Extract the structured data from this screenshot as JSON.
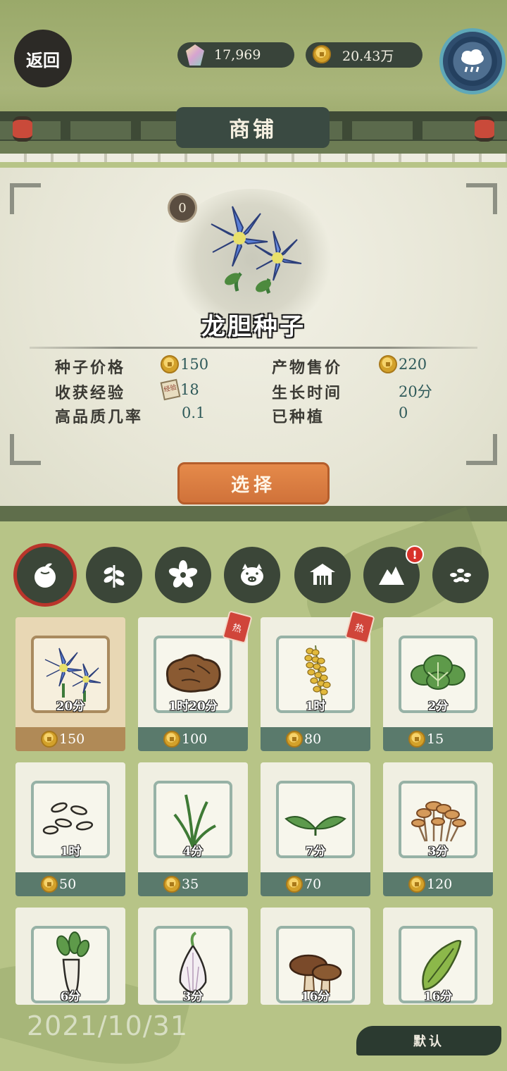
{
  "header": {
    "back_label": "返回",
    "gems": "17,969",
    "coins": "20.43万",
    "shop_title": "商铺"
  },
  "detail": {
    "owned_count": "0",
    "name": "龙胆种子",
    "stats": [
      {
        "label": "种子价格",
        "value": "150",
        "icon": "coin-icon"
      },
      {
        "label": "产物售价",
        "value": "220",
        "icon": "coin-icon"
      },
      {
        "label": "收获经验",
        "value": "18",
        "icon": "scroll-icon"
      },
      {
        "label": "生长时间",
        "value": "20分",
        "icon": ""
      },
      {
        "label": "高品质几率",
        "value": "0.1",
        "icon": ""
      },
      {
        "label": "已种植",
        "value": "0",
        "icon": ""
      }
    ],
    "select_label": "选择"
  },
  "tabs": [
    {
      "name": "crop",
      "icon": "fruit-icon",
      "active": true
    },
    {
      "name": "herb",
      "icon": "herb-icon",
      "active": false
    },
    {
      "name": "flower",
      "icon": "flower-icon",
      "active": false
    },
    {
      "name": "livestock",
      "icon": "pig-icon",
      "active": false
    },
    {
      "name": "building",
      "icon": "house-icon",
      "active": false
    },
    {
      "name": "mountain",
      "icon": "mountain-icon",
      "active": false,
      "alert": "!"
    },
    {
      "name": "seeds",
      "icon": "seeds-icon",
      "active": false
    }
  ],
  "items": [
    {
      "art": "gentian-flower",
      "time": "20分",
      "price": "150",
      "selected": true,
      "tag": false
    },
    {
      "art": "ginseng-root",
      "time": "1时20分",
      "price": "100",
      "selected": false,
      "tag": true
    },
    {
      "art": "millet",
      "time": "1时",
      "price": "80",
      "selected": false,
      "tag": true
    },
    {
      "art": "bok-choy",
      "time": "2分",
      "price": "15",
      "selected": false,
      "tag": false
    },
    {
      "art": "rice-grains",
      "time": "1时",
      "price": "50",
      "selected": false,
      "tag": false
    },
    {
      "art": "grass-sprout",
      "time": "4分",
      "price": "35",
      "selected": false,
      "tag": false
    },
    {
      "art": "tea-leaves",
      "time": "7分",
      "price": "70",
      "selected": false,
      "tag": false
    },
    {
      "art": "enoki-mushrooms",
      "time": "3分",
      "price": "120",
      "selected": false,
      "tag": false
    },
    {
      "art": "white-radish",
      "time": "6分",
      "price": "",
      "selected": false,
      "tag": false
    },
    {
      "art": "garlic",
      "time": "3分",
      "price": "",
      "selected": false,
      "tag": false
    },
    {
      "art": "shiitake",
      "time": "16分",
      "price": "",
      "selected": false,
      "tag": false
    },
    {
      "art": "pea-pod",
      "time": "16分",
      "price": "",
      "selected": false,
      "tag": false
    }
  ],
  "footer": {
    "date": "2021/10/31",
    "default_label": "默认"
  },
  "colors": {
    "accent_orange": "#d0723a",
    "panel_teal": "#5a7a6c",
    "selected_gold": "#b08a57",
    "dark_ink": "#2c2a26"
  }
}
